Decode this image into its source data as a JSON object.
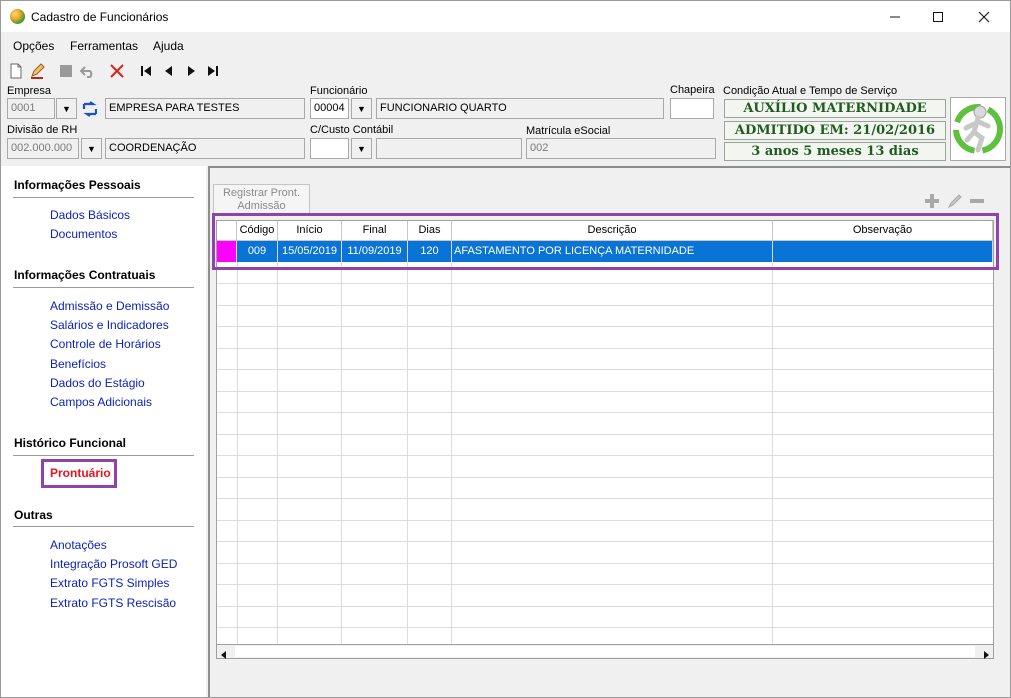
{
  "window": {
    "title": "Cadastro de Funcionários",
    "minimize_icon": "minimize-icon",
    "maximize_icon": "maximize-icon",
    "close_icon": "close-icon"
  },
  "menu": [
    "Opções",
    "Ferramentas",
    "Ajuda"
  ],
  "toolbar": [
    "new-document-icon",
    "edit-icon",
    "stop-icon",
    "undo-icon",
    "delete-icon",
    "first-record-icon",
    "previous-record-icon",
    "next-record-icon",
    "last-record-icon"
  ],
  "header": {
    "empresa_label": "Empresa",
    "empresa_code": "0001",
    "empresa_name": "EMPRESA PARA TESTES",
    "divisao_label": "Divisão de RH",
    "divisao_code": "002.000.000",
    "divisao_name": "COORDENAÇÃO",
    "funcionario_label": "Funcionário",
    "funcionario_code": "00004",
    "funcionario_name": "FUNCIONARIO QUARTO",
    "ccusto_label": "C/Custo Contábil",
    "ccusto_code": "",
    "ccusto_name": "",
    "matricula_label": "Matrícula eSocial",
    "matricula_value": "002",
    "chapeira_label": "Chapeira",
    "chapeira_value": "",
    "condicao_label": "Condição Atual e Tempo de Serviço",
    "status1": "AUXÍLIO MATERNIDADE",
    "status2": "ADMITIDO EM: 21/02/2016",
    "status3": "3 anos 5 meses 13 dias",
    "status_color": "#1f5c1f"
  },
  "sidebar": {
    "sections": [
      {
        "title": "Informações Pessoais",
        "items": [
          "Dados Básicos",
          "Documentos"
        ]
      },
      {
        "title": "Informações Contratuais",
        "items": [
          "Admissão e Demissão",
          "Salários e Indicadores",
          "Controle de Horários",
          "Benefícios",
          "Dados do Estágio",
          "Campos Adicionais"
        ]
      },
      {
        "title": "Histórico Funcional",
        "items": [
          "Prontuário"
        ]
      },
      {
        "title": "Outras",
        "items": [
          "Anotações",
          "Integração Prosoft GED",
          "Extrato FGTS Simples",
          "Extrato FGTS Rescisão"
        ]
      }
    ],
    "active_item": "Prontuário",
    "active_color": "#e8141e",
    "link_color": "#0a1fb8"
  },
  "main": {
    "register_button": "Registrar Pront. Admissão",
    "actions": [
      "add-icon",
      "edit-icon",
      "remove-icon"
    ],
    "columns": [
      "Código",
      "Início",
      "Final",
      "Dias",
      "Descrição",
      "Observação"
    ],
    "rows": [
      {
        "codigo": "009",
        "inicio": "15/05/2019",
        "final": "11/09/2019",
        "dias": "120",
        "descricao": "AFASTAMENTO POR LICENÇA MATERNIDADE",
        "observacao": ""
      }
    ],
    "selection_color": "#0a74d6",
    "row_marker_color": "#ff00ff",
    "highlight_color": "#8e44a8"
  }
}
